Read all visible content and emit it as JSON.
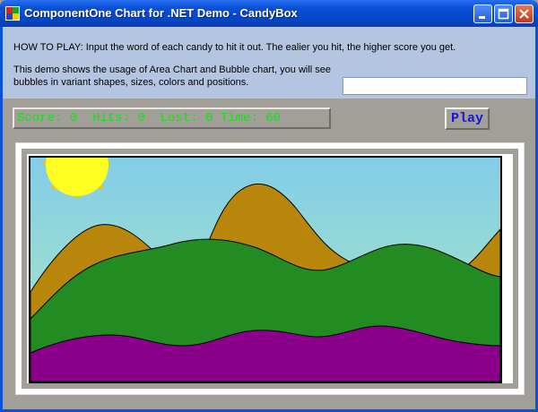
{
  "window": {
    "title": "ComponentOne Chart for .NET Demo - CandyBox",
    "icons": {
      "app": "app-icon",
      "minimize": "minimize-icon",
      "maximize": "maximize-icon",
      "close": "close-icon"
    }
  },
  "info": {
    "how_to_play": "HOW TO PLAY: Input the word of each candy to hit it out. The ealier you hit, the higher score you get.",
    "description": "This demo shows the usage of Area Chart and Bubble chart, you will see bubbles in variant shapes, sizes, colors and positions.",
    "word_input_value": ""
  },
  "status": {
    "score_line": "Score: 0  Hits: 0  Lost: 0 Time: 60",
    "text_color": "#16e016"
  },
  "controls": {
    "play_label": "Play",
    "play_color": "#1515e8"
  },
  "scene": {
    "sky_top": "#86d0e6",
    "sky_bottom": "#a6e6c4",
    "sun_color": "#ffff2a",
    "sun_ray_color": "#f0c820",
    "back_hills_color": "#b8860b",
    "mid_hills_color": "#228b22",
    "front_hills_color": "#8b008b"
  }
}
